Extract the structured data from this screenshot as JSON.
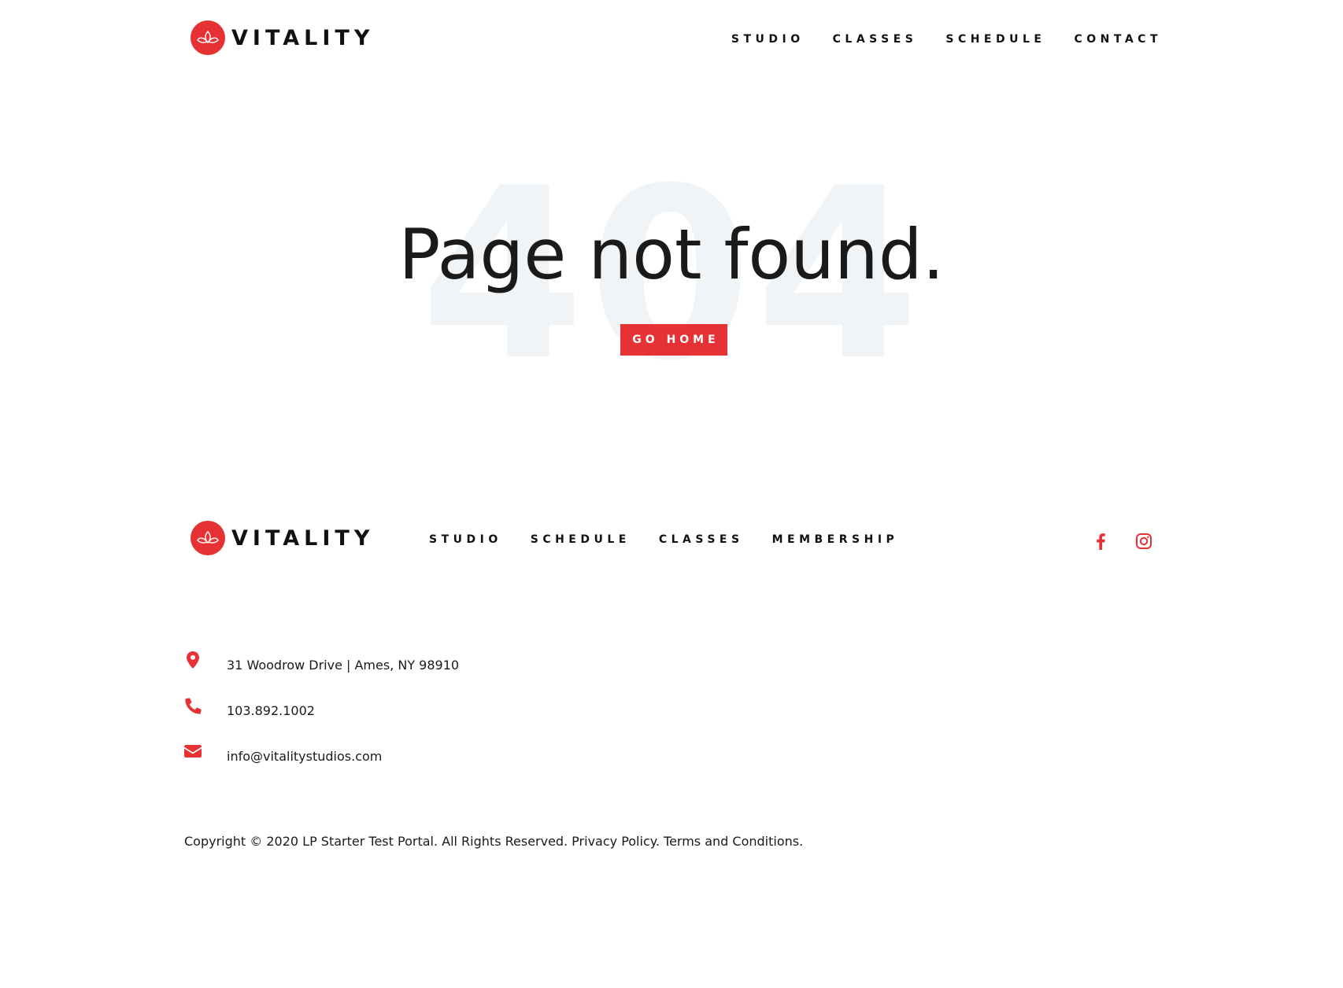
{
  "brand": {
    "name": "VITALITY",
    "accent_color": "#e63234",
    "logo_icon": "lotus-icon"
  },
  "header": {
    "nav": [
      "STUDIO",
      "CLASSES",
      "SCHEDULE",
      "CONTACT"
    ]
  },
  "hero": {
    "background_text": "404",
    "title": "Page not found.",
    "button_label": "GO HOME"
  },
  "footer": {
    "nav": [
      "STUDIO",
      "SCHEDULE",
      "CLASSES",
      "MEMBERSHIP"
    ],
    "social": [
      {
        "icon": "facebook-icon"
      },
      {
        "icon": "instagram-icon"
      }
    ],
    "contact": {
      "address": "31 Woodrow Drive | Ames, NY 98910",
      "phone": "103.892.1002",
      "email": "info@vitalitystudios.com"
    },
    "copyright": {
      "text": "Copyright © 2020 LP Starter Test Portal. All Rights Reserved.",
      "privacy_label": "Privacy Policy.",
      "terms_label": "Terms and Conditions."
    }
  }
}
